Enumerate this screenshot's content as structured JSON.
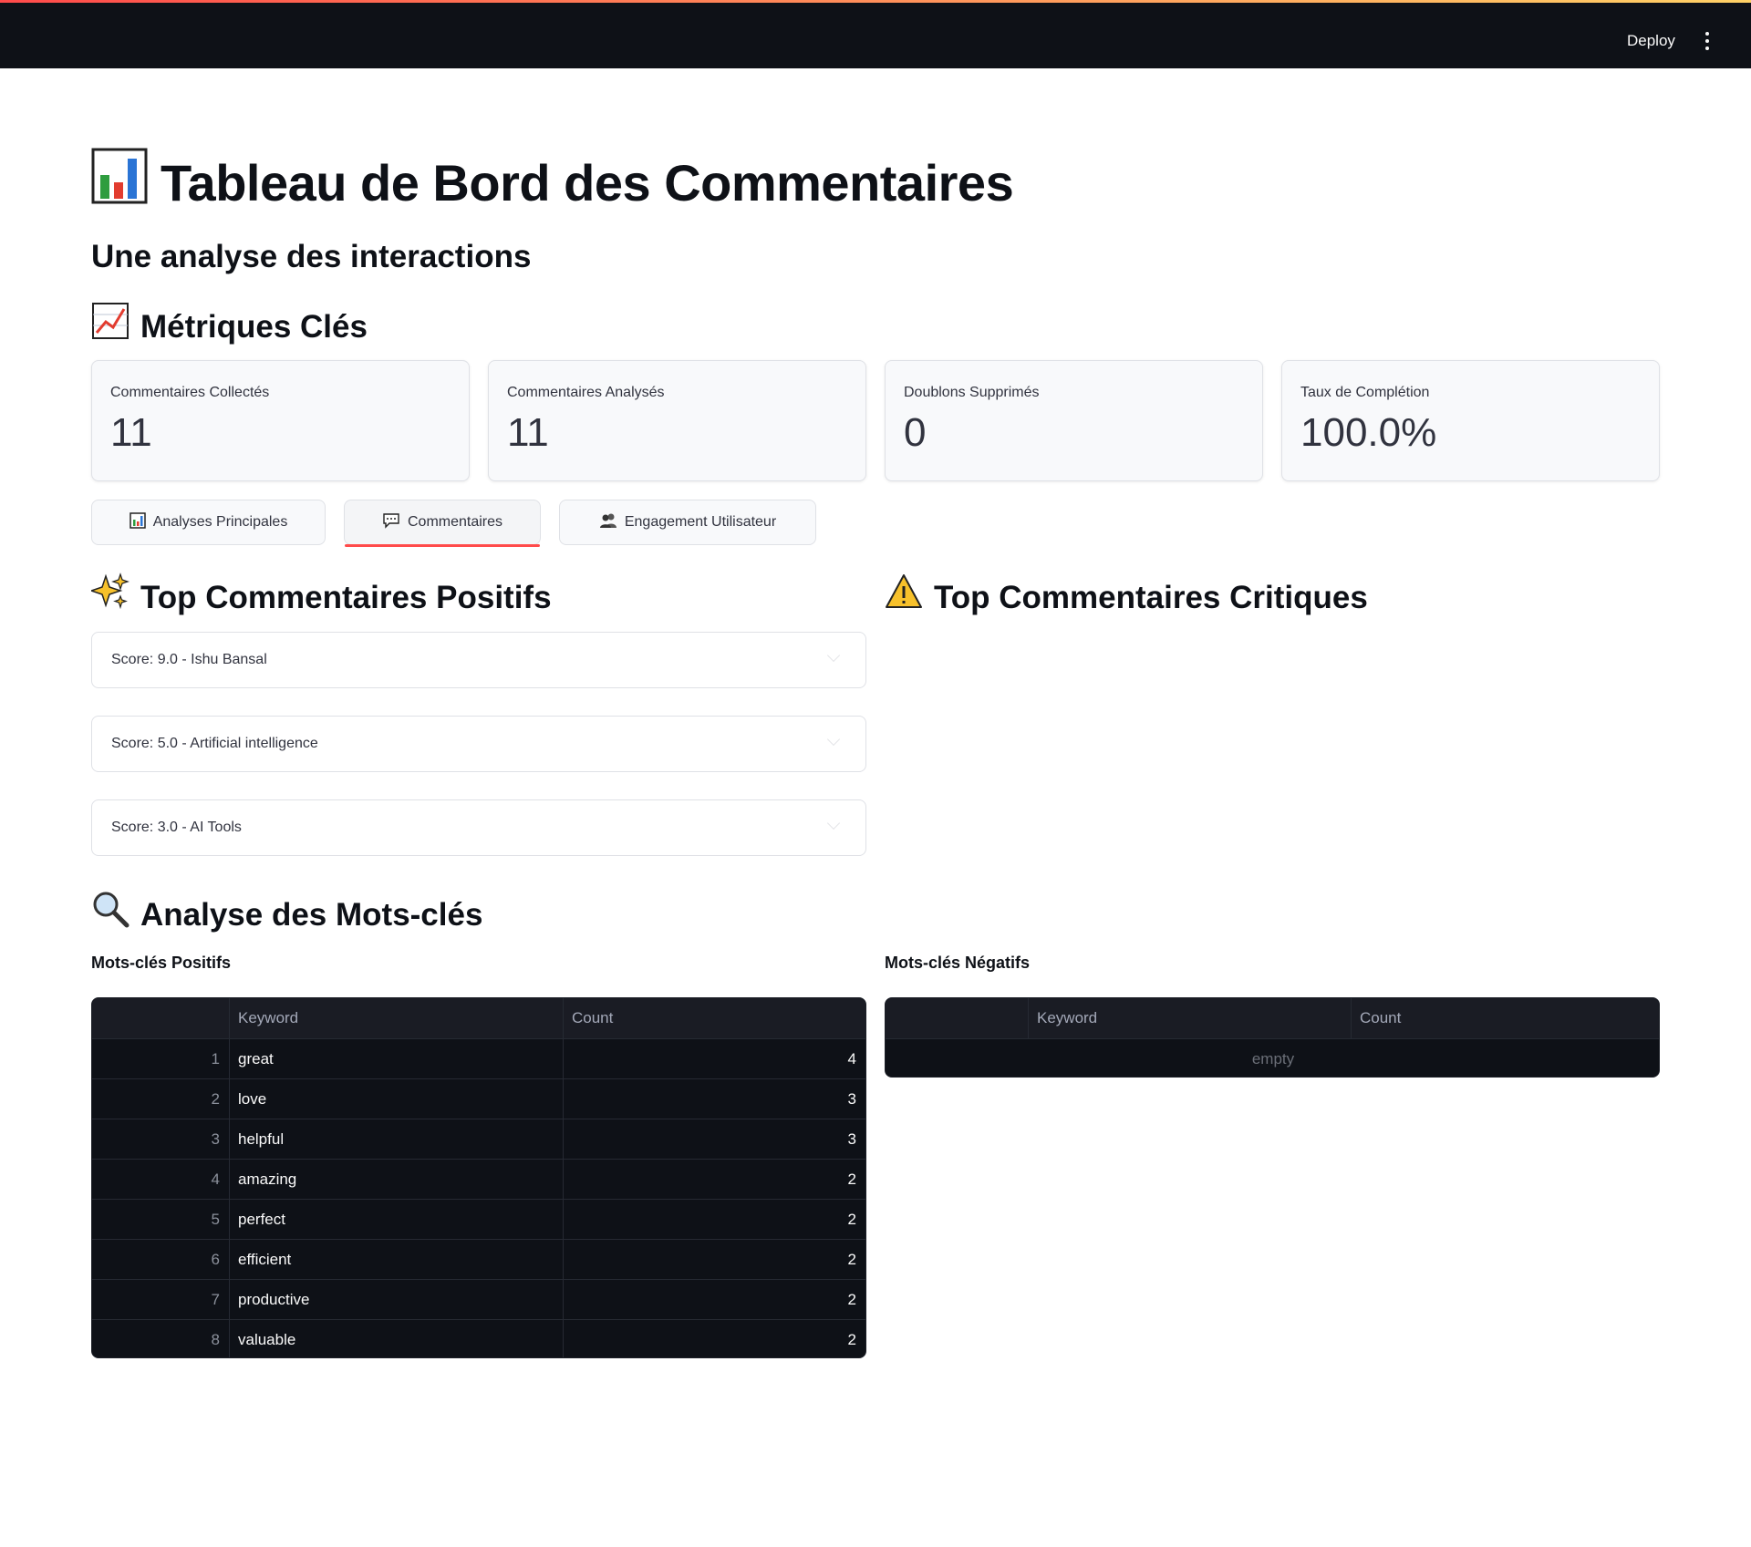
{
  "topbar": {
    "deploy_label": "Deploy",
    "menu_icon": "kebab-menu-icon"
  },
  "header": {
    "title": "Tableau de Bord des Commentaires",
    "subtitle": "Une analyse des interactions"
  },
  "metrics_section": {
    "title": "Métriques Clés",
    "items": [
      {
        "label": "Commentaires Collectés",
        "value": "11"
      },
      {
        "label": "Commentaires Analysés",
        "value": "11"
      },
      {
        "label": "Doublons Supprimés",
        "value": "0"
      },
      {
        "label": "Taux de Complétion",
        "value": "100.0%"
      }
    ]
  },
  "tabs": [
    {
      "label": "Analyses Principales",
      "icon": "bar-chart-icon",
      "active": false
    },
    {
      "label": "Commentaires",
      "icon": "speech-bubble-icon",
      "active": true
    },
    {
      "label": "Engagement Utilisateur",
      "icon": "users-icon",
      "active": false
    }
  ],
  "positive": {
    "title": "Top Commentaires Positifs",
    "items": [
      "Score: 9.0 - Ishu Bansal",
      "Score: 5.0 - Artificial intelligence",
      "Score: 3.0 - AI Tools"
    ]
  },
  "critical": {
    "title": "Top Commentaires Critiques"
  },
  "keywords": {
    "title": "Analyse des Mots-clés",
    "positive_label": "Mots-clés Positifs",
    "negative_label": "Mots-clés Négatifs",
    "columns": [
      "Keyword",
      "Count"
    ],
    "positive_rows": [
      {
        "index": "1",
        "keyword": "great",
        "count": "4"
      },
      {
        "index": "2",
        "keyword": "love",
        "count": "3"
      },
      {
        "index": "3",
        "keyword": "helpful",
        "count": "3"
      },
      {
        "index": "4",
        "keyword": "amazing",
        "count": "2"
      },
      {
        "index": "5",
        "keyword": "perfect",
        "count": "2"
      },
      {
        "index": "6",
        "keyword": "efficient",
        "count": "2"
      },
      {
        "index": "7",
        "keyword": "productive",
        "count": "2"
      },
      {
        "index": "8",
        "keyword": "valuable",
        "count": "2"
      }
    ],
    "negative_empty": "empty"
  }
}
